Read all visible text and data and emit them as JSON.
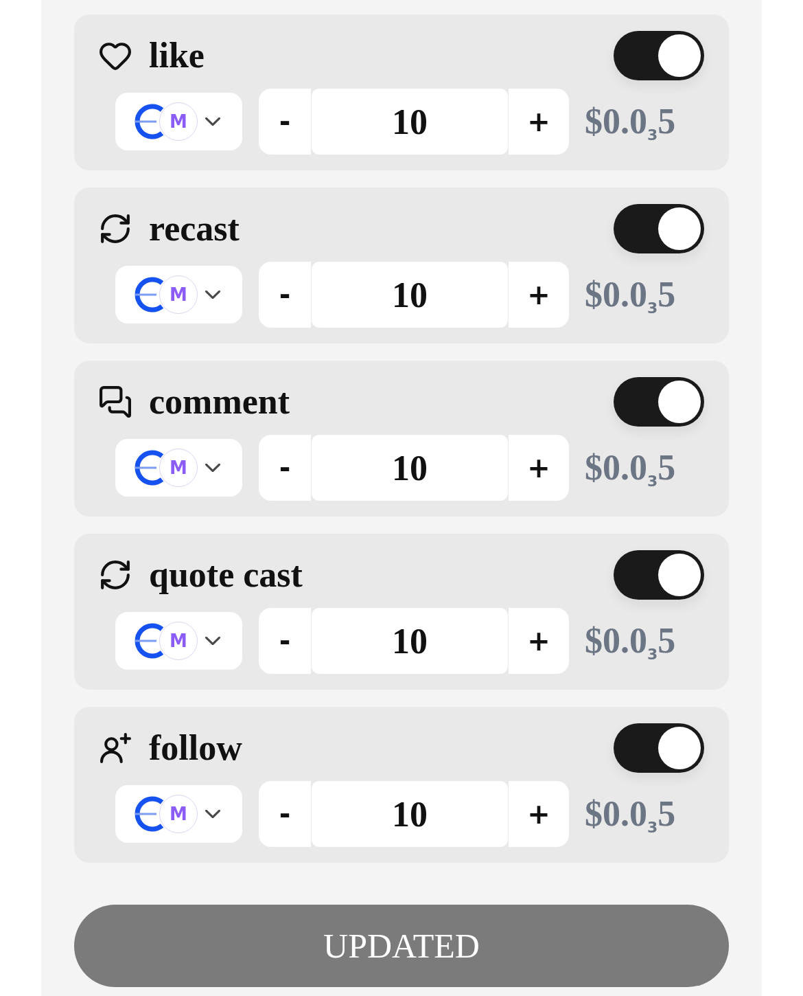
{
  "actions": [
    {
      "kind": "like",
      "label": "like",
      "enabled": true,
      "token_symbol": "M",
      "decrement": "-",
      "amount": "10",
      "increment": "+",
      "price": "$0.0$_{3}$5"
    },
    {
      "kind": "recast",
      "label": "recast",
      "enabled": true,
      "token_symbol": "M",
      "decrement": "-",
      "amount": "10",
      "increment": "+",
      "price": "$0.0$_{3}$5"
    },
    {
      "kind": "comment",
      "label": "comment",
      "enabled": true,
      "token_symbol": "M",
      "decrement": "-",
      "amount": "10",
      "increment": "+",
      "price": "$0.0$_{3}$5"
    },
    {
      "kind": "quote_cast",
      "label": "quote cast",
      "enabled": true,
      "token_symbol": "M",
      "decrement": "-",
      "amount": "10",
      "increment": "+",
      "price": "$0.0$_{3}$5"
    },
    {
      "kind": "follow",
      "label": "follow",
      "enabled": true,
      "token_symbol": "M",
      "decrement": "-",
      "amount": "10",
      "increment": "+",
      "price": "$0.0$_{3}$5"
    }
  ],
  "submit": {
    "label": "UPDATED",
    "disabled": true
  }
}
